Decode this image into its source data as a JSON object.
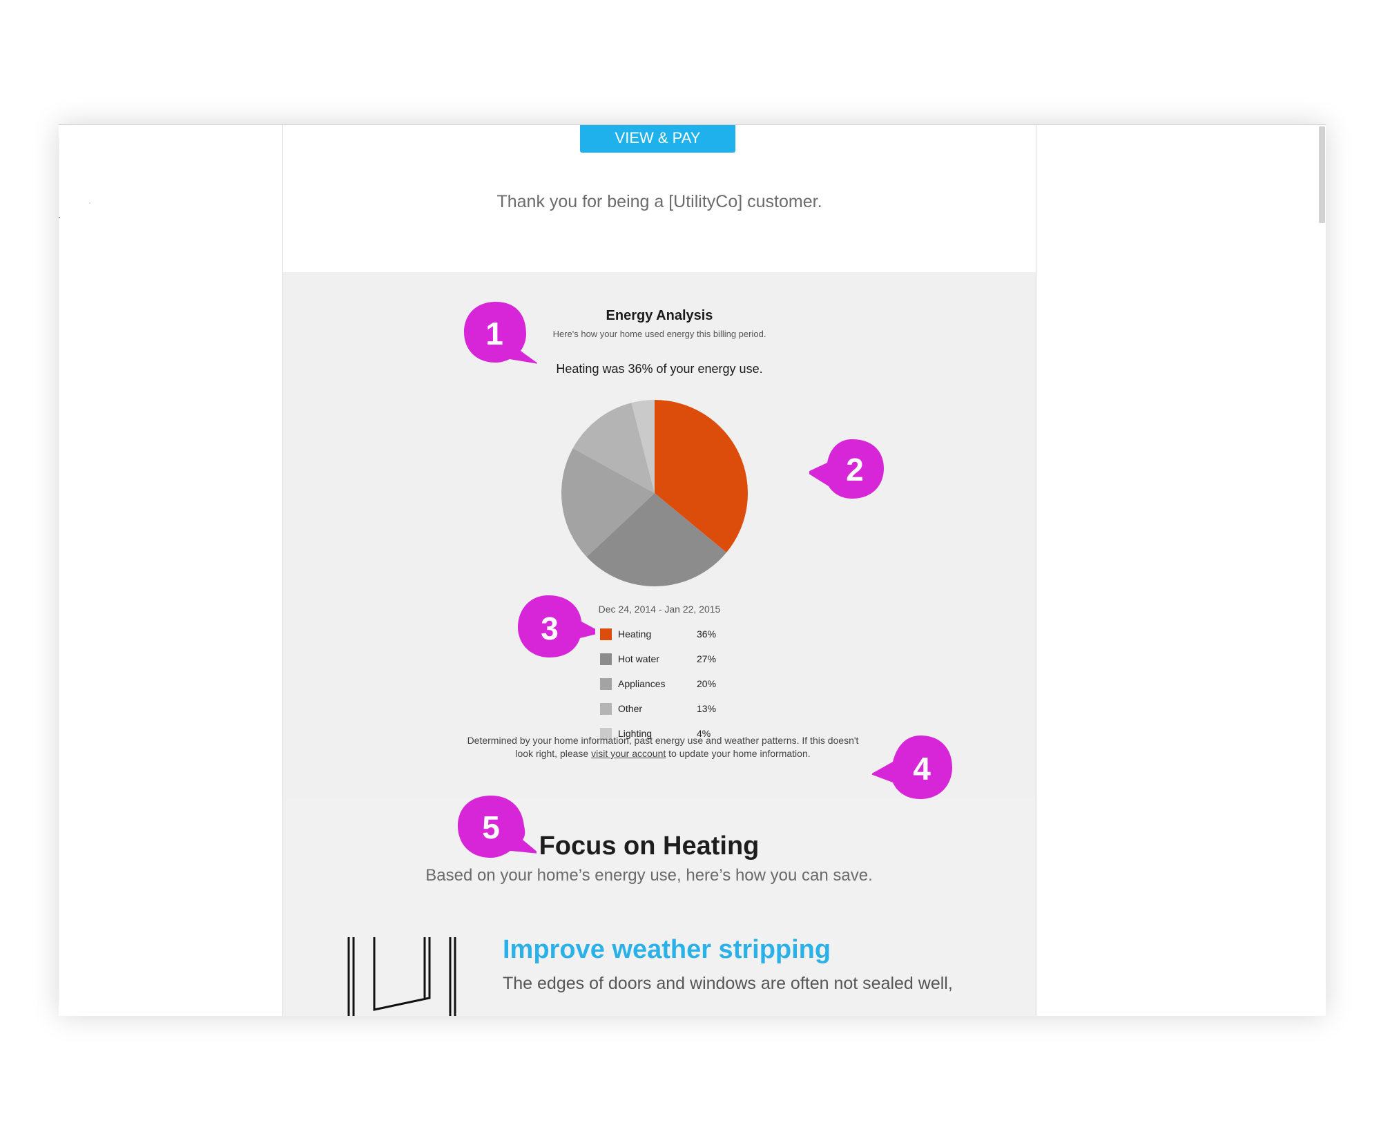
{
  "email": {
    "pay_button": "VIEW & PAY",
    "thanks_text": "Thank you for being a [UtilityCo] customer."
  },
  "energy_analysis": {
    "title": "Energy Analysis",
    "subtitle": "Here's how your home used energy this billing period.",
    "headline": "Heating was 36% of your energy use.",
    "period": "Dec 24, 2014 - Jan 22, 2015",
    "note_before": "Determined by your home information, past energy use and weather patterns. If this doesn't look right, please ",
    "note_link": "visit your account",
    "note_after": " to update your home information."
  },
  "chart_data": {
    "type": "pie",
    "categories": [
      "Heating",
      "Hot water",
      "Appliances",
      "Other",
      "Lighting"
    ],
    "values": [
      36,
      27,
      20,
      13,
      4
    ],
    "value_labels": [
      "36%",
      "27%",
      "20%",
      "13%",
      "4%"
    ],
    "colors": [
      "#dc4c0b",
      "#8d8c8c",
      "#a3a3a3",
      "#b4b4b4",
      "#cacaca"
    ]
  },
  "focus": {
    "title": "Focus on Heating",
    "subtitle": "Based on your home’s energy use, here’s how you can save."
  },
  "tip": {
    "title": "Improve weather stripping",
    "body": "The edges of doors and windows are often not sealed well,",
    "icon": "window-frame-icon"
  },
  "callouts": [
    "1",
    "2",
    "3",
    "4",
    "5"
  ],
  "colors": {
    "accent": "#1fb1ec",
    "callout": "#d626d8",
    "heading_blue": "#2ab2e8"
  }
}
